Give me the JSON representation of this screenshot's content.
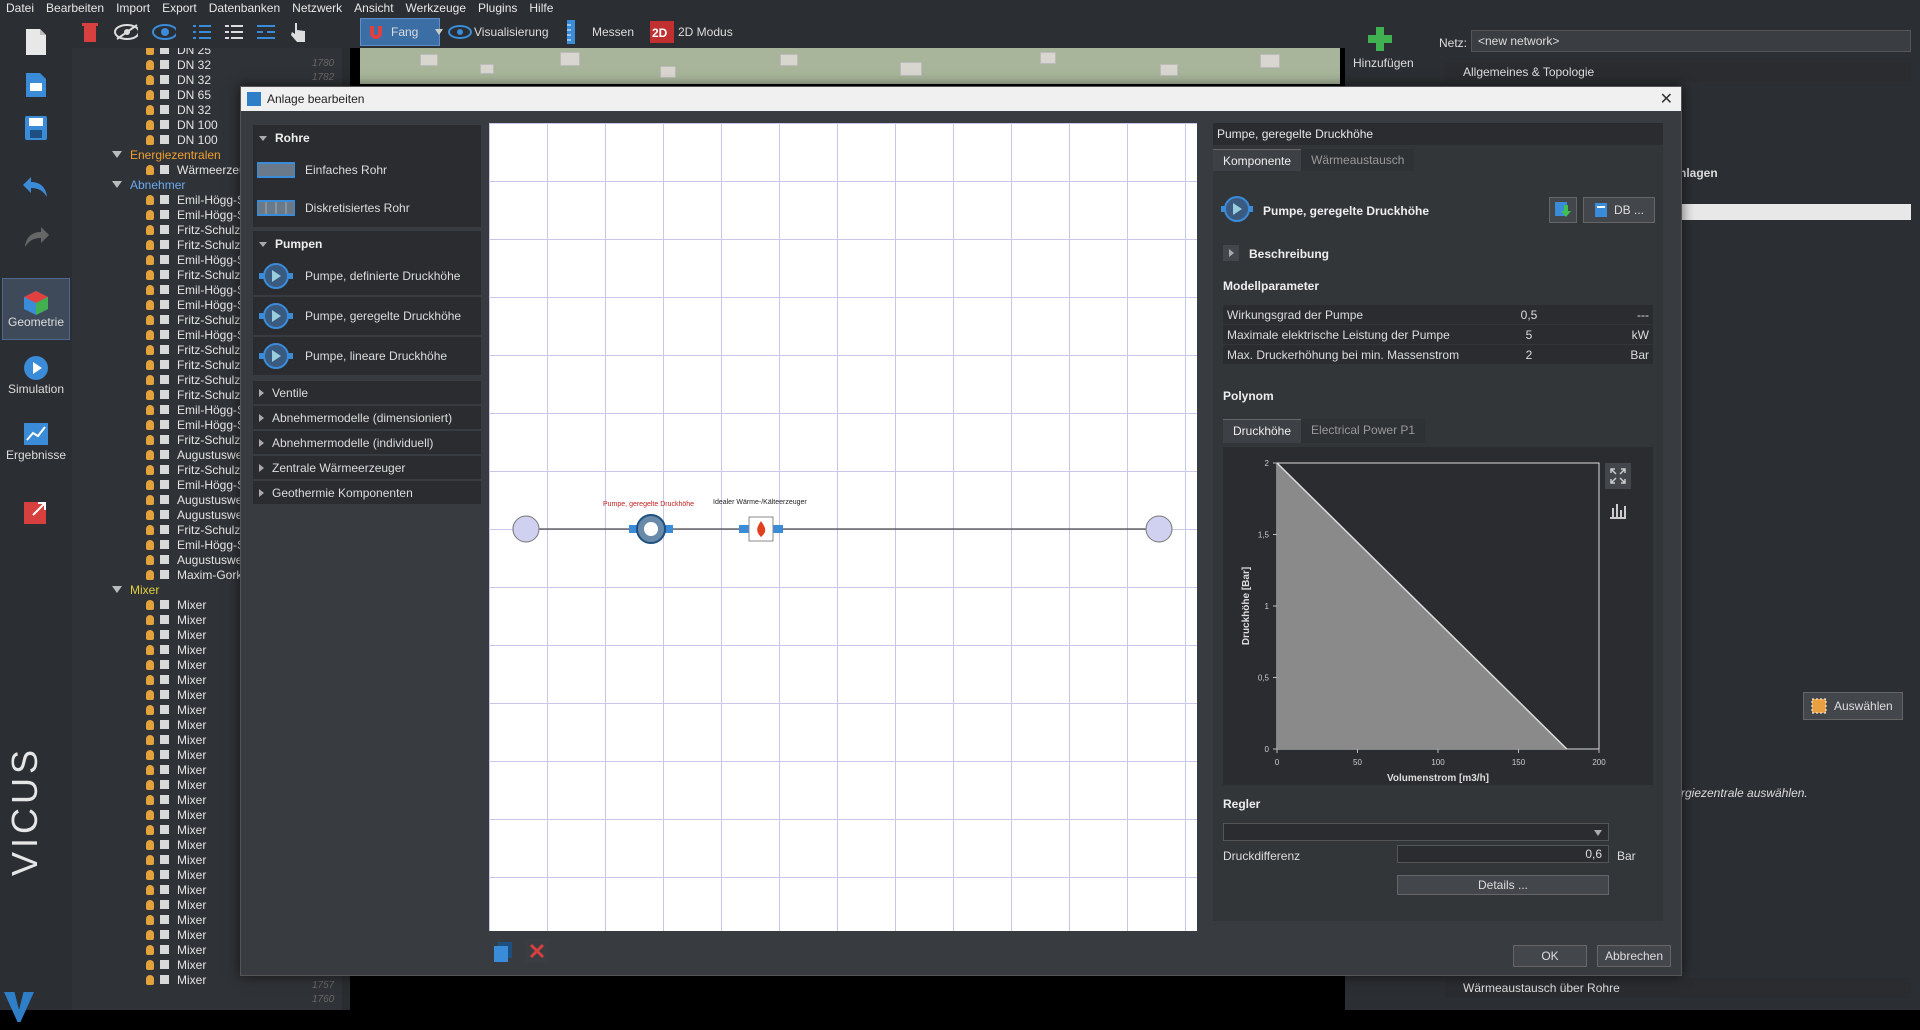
{
  "menu": [
    "Datei",
    "Bearbeiten",
    "Import",
    "Export",
    "Datenbanken",
    "Netzwerk",
    "Ansicht",
    "Werkzeuge",
    "Plugins",
    "Hilfe"
  ],
  "toolbar": {
    "fang": "Fang",
    "visualisierung": "Visualisierung",
    "messen": "Messen",
    "mode2d": "2D Modus",
    "hinzufuegen": "Hinzufügen",
    "netz_label": "Netz:",
    "netz_value": "<new network>"
  },
  "leftbar": {
    "geometrie": "Geometrie",
    "simulation": "Simulation",
    "ergebnisse": "Ergebnisse",
    "brand": "VICUS"
  },
  "tree": {
    "top_items": [
      "DN 25",
      "DN 32",
      "DN 32",
      "DN 65",
      "DN 32",
      "DN 100",
      "DN 100"
    ],
    "scroll_nums": [
      "1780",
      "1782"
    ],
    "energiezentralen": "Energiezentralen",
    "waermeerzeuger": "Wärmeerzeu",
    "abnehmer": "Abnehmer",
    "abnehmer_items": [
      "Emil-Högg-S",
      "Emil-Högg-S",
      "Fritz-Schulze",
      "Fritz-Schulze",
      "Emil-Högg-S",
      "Fritz-Schulze",
      "Emil-Högg-S",
      "Emil-Högg-S",
      "Fritz-Schulze",
      "Emil-Högg-S",
      "Fritz-Schulze",
      "Fritz-Schulze",
      "Fritz-Schulze",
      "Fritz-Schulze",
      "Emil-Högg-S",
      "Emil-Högg-S",
      "Fritz-Schulze",
      "Augustuswe",
      "Fritz-Schulze",
      "Emil-Högg-S",
      "Augustuswe",
      "Augustuswe",
      "Fritz-Schulze",
      "Emil-Högg-S",
      "Augustuswe",
      "Maxim-Gork"
    ],
    "mixer": "Mixer",
    "mixer_item": "Mixer",
    "mixer_count": 26,
    "bottom_nums": [
      "1757",
      "1760"
    ]
  },
  "rightpanel": {
    "allgemeines": "Allgemeines & Topologie",
    "anlagen": "nlagen",
    "auswaehlen": "Auswählen",
    "hint": "rgiezentrale auswählen.",
    "waermeaustausch": "Wärmeaustausch über Rohre"
  },
  "dialog": {
    "title": "Anlage bearbeiten",
    "library": {
      "rohre": "Rohre",
      "einfaches_rohr": "Einfaches Rohr",
      "diskretisiertes_rohr": "Diskretisiertes Rohr",
      "pumpen": "Pumpen",
      "pumpe_def": "Pumpe, definierte Druckhöhe",
      "pumpe_ger": "Pumpe, geregelte Druckhöhe",
      "pumpe_lin": "Pumpe, lineare Druckhöhe",
      "collapsed": [
        "Ventile",
        "Abnehmermodelle (dimensioniert)",
        "Abnehmermodelle (individuell)",
        "Zentrale Wärmeerzeuger",
        "Geothermie Komponenten"
      ]
    },
    "canvas": {
      "pump_label": "Pumpe, geregelte Druckhöhe",
      "heater_label": "Idealer Wärme-/Kälteerzeuger"
    },
    "props": {
      "title": "Pumpe, geregelte Druckhöhe",
      "tabs": [
        "Komponente",
        "Wärmeaustausch"
      ],
      "component_name": "Pumpe, geregelte Druckhöhe",
      "db_button": "DB ...",
      "beschreibung": "Beschreibung",
      "modellparameter": "Modellparameter",
      "params": [
        {
          "name": "Wirkungsgrad der Pumpe",
          "value": "0,5",
          "unit": "---"
        },
        {
          "name": "Maximale elektrische Leistung der Pumpe",
          "value": "5",
          "unit": "kW"
        },
        {
          "name": "Max. Druckerhöhung bei min. Massenstrom",
          "value": "2",
          "unit": "Bar"
        }
      ],
      "polynom": "Polynom",
      "chart_tabs": [
        "Druckhöhe",
        "Electrical Power P1"
      ],
      "regler": "Regler",
      "druckdifferenz_label": "Druckdifferenz",
      "druckdifferenz_value": "0,6",
      "druckdifferenz_unit": "Bar",
      "details": "Details ..."
    },
    "ok": "OK",
    "cancel": "Abbrechen"
  },
  "chart_data": {
    "type": "area",
    "x": [
      0,
      180
    ],
    "y": [
      2,
      0
    ],
    "xlabel": "Volumenstrom [m3/h]",
    "ylabel": "Druckhöhe [Bar]",
    "xlim": [
      0,
      200
    ],
    "ylim": [
      0,
      2
    ],
    "xticks": [
      "0",
      "50",
      "100",
      "150",
      "200"
    ],
    "yticks": [
      "0",
      "0,5",
      "1",
      "1,5",
      "2"
    ]
  }
}
